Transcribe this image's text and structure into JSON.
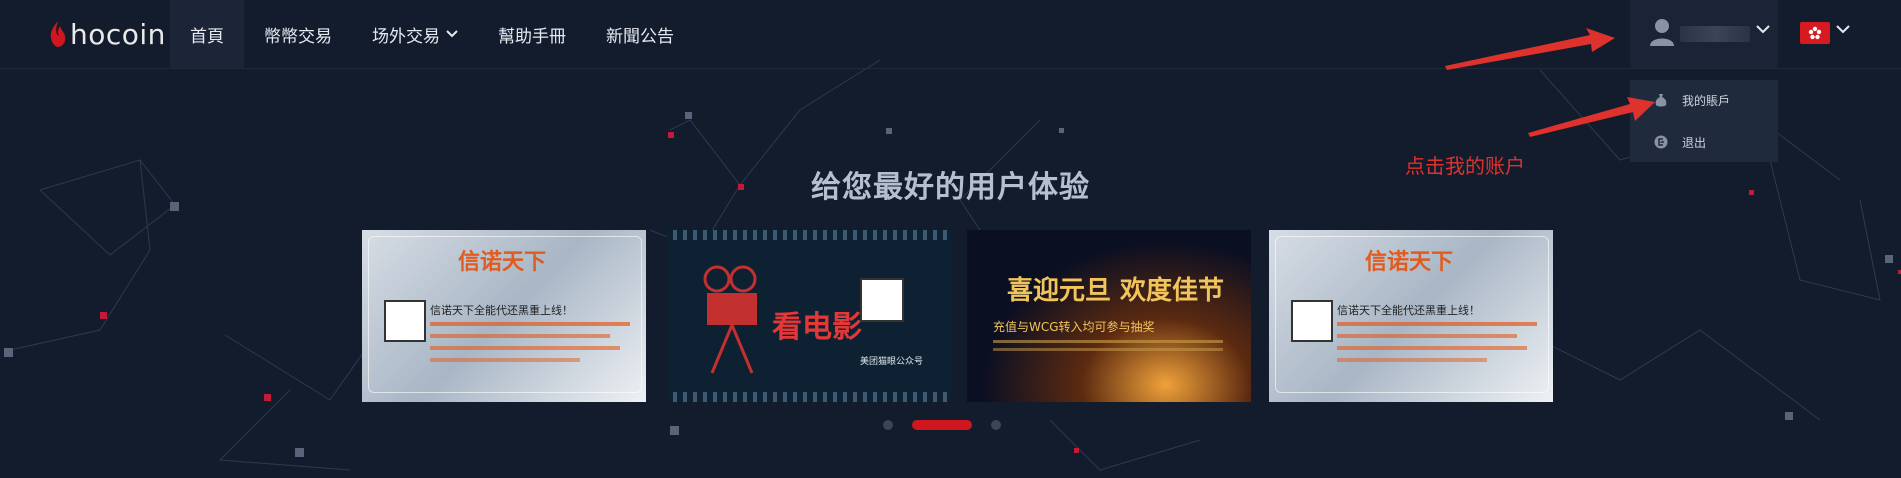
{
  "logo": {
    "text": "hocoin"
  },
  "nav": {
    "items": [
      {
        "label": "首頁"
      },
      {
        "label": "幣幣交易"
      },
      {
        "label": "场外交易"
      },
      {
        "label": "幫助手冊"
      },
      {
        "label": "新聞公告"
      }
    ]
  },
  "user_menu": {
    "items": [
      {
        "label": "我的賬戶",
        "icon": "money-bag-icon"
      },
      {
        "label": "退出",
        "icon": "logout-icon"
      }
    ]
  },
  "annotation": {
    "text": "点击我的账户"
  },
  "hero": {
    "headline": "给您最好的用户体验"
  },
  "banners": [
    {
      "title": "信诺天下",
      "subtitle": "信诺天下全能代还黑重上线！"
    },
    {
      "title": "看电影",
      "subtitle": "美团猫眼公众号"
    },
    {
      "title": "喜迎元旦 欢度佳节",
      "subtitle": "充值与WCG转入均可参与抽奖"
    },
    {
      "title": "信诺天下",
      "subtitle": "信诺天下全能代还黑重上线！"
    }
  ],
  "carousel": {
    "active_index": 1,
    "count": 3
  },
  "colors": {
    "accent": "#d0161e",
    "background": "#131c2d",
    "annotation": "#e0322d"
  }
}
